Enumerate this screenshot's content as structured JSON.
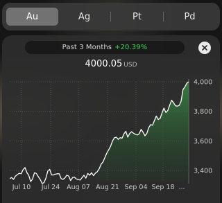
{
  "metals_picker": {
    "segments": [
      {
        "label": "Au",
        "selected": true
      },
      {
        "label": "Ag",
        "selected": false
      },
      {
        "label": "Pt",
        "selected": false
      },
      {
        "label": "Pd",
        "selected": false
      }
    ]
  },
  "detail_card": {
    "period_label": "Past 3 Months",
    "change_label": "+20.39%",
    "price": "4000.05",
    "currency": "USD",
    "close_icon": "close-icon"
  },
  "colors": {
    "positive": "#41d05a",
    "line": "#ffffff",
    "area_fill": "#2f7a3a"
  },
  "chart_data": {
    "type": "line",
    "x_tick_labels": [
      "Jul 10",
      "Jul 24",
      "Aug 07",
      "Aug 21",
      "Sep 04",
      "Sep 18",
      "..."
    ],
    "y_tick_labels": [
      "3,400",
      "3,600",
      "3,800",
      "4,000"
    ],
    "ylim": [
      3330,
      4000
    ],
    "grid": true,
    "series": [
      {
        "values": [
          3345,
          3352,
          3340,
          3362,
          3372,
          3381,
          3378,
          3405,
          3420,
          3386,
          3368,
          3325,
          3342,
          3385,
          3380,
          3358,
          3340,
          3312,
          3318,
          3348,
          3395,
          3408,
          3370,
          3370,
          3375,
          3378,
          3378,
          3345,
          3340,
          3350,
          3368,
          3362,
          3332,
          3352,
          3355,
          3342,
          3338,
          3335,
          3352,
          3368,
          3348,
          3380,
          3368,
          3385,
          3365,
          3382,
          3392,
          3412,
          3442,
          3458,
          3488,
          3518,
          3540,
          3565,
          3600,
          3622,
          3625,
          3610,
          3622,
          3618,
          3648,
          3665,
          3625,
          3650,
          3662,
          3652,
          3645,
          3640,
          3648,
          3678,
          3660,
          3635,
          3650,
          3690,
          3710,
          3706,
          3738,
          3768,
          3745,
          3752,
          3790,
          3822,
          3792,
          3805,
          3842,
          3875,
          3860,
          3838,
          3835,
          3840,
          3868,
          3948,
          3965,
          3990,
          4000
        ]
      }
    ]
  }
}
